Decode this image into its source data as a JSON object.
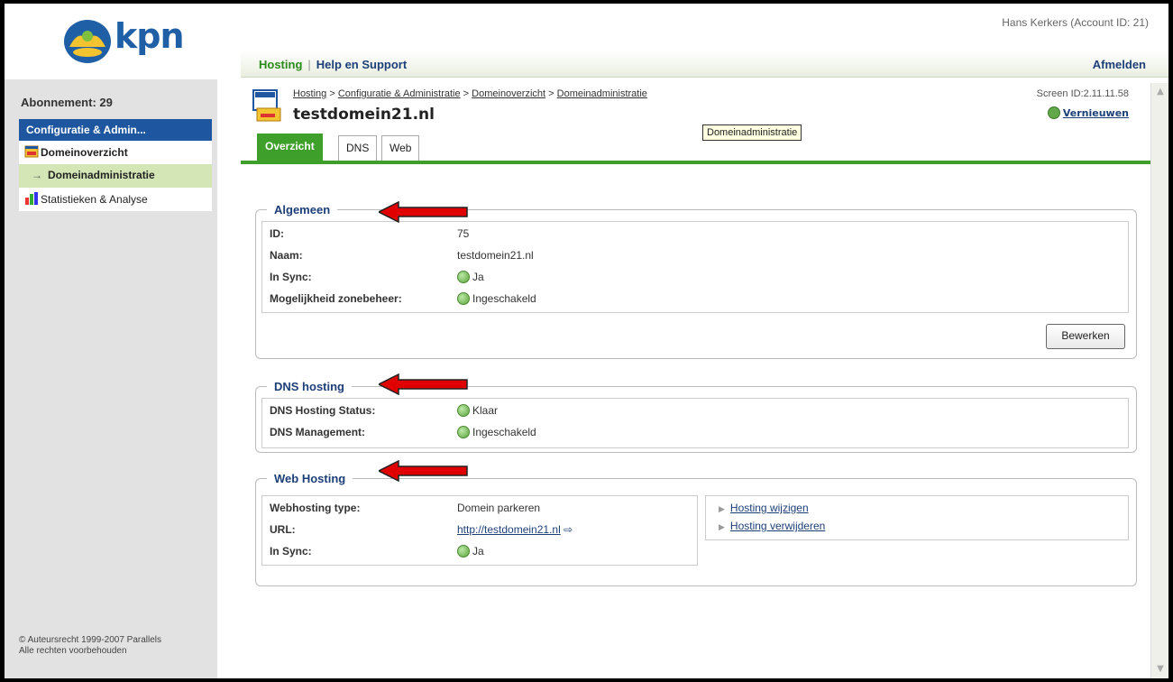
{
  "header": {
    "logo_text": "kpn",
    "user_info": "Hans Kerkers (Account ID: 21)",
    "nav": {
      "hosting": "Hosting",
      "separator": "|",
      "help": "Help en Support",
      "logout": "Afmelden"
    }
  },
  "sidebar": {
    "subscription": "Abonnement: 29",
    "section": "Configuratie & Admin...",
    "items": [
      {
        "label": "Domeinoverzicht",
        "icon": "domain-icon"
      },
      {
        "label": "Domeinadministratie",
        "icon": "arrow-icon"
      },
      {
        "label": "Statistieken & Analyse",
        "icon": "chart-icon"
      }
    ],
    "copyright_line1": "© Auteursrecht 1999-2007 Parallels",
    "copyright_line2": "Alle rechten voorbehouden"
  },
  "main": {
    "breadcrumb": {
      "items": [
        "Hosting",
        "Configuratie & Administratie",
        "Domeinoverzicht",
        "Domeinadministratie"
      ],
      "separator": ">"
    },
    "title": "testdomein21.nl",
    "screen_id": "Screen ID:2.11.11.58",
    "refresh": "Vernieuwen",
    "tooltip": "Domeinadministratie",
    "tabs": [
      "Overzicht",
      "DNS",
      "Web"
    ],
    "general": {
      "legend": "Algemeen",
      "rows": [
        {
          "label": "ID:",
          "value": "75"
        },
        {
          "label": "Naam:",
          "value": "testdomein21.nl"
        },
        {
          "label": "In Sync:",
          "value": "Ja"
        },
        {
          "label": "Mogelijkheid zonebeheer:",
          "value": "Ingeschakeld"
        }
      ],
      "edit_button": "Bewerken"
    },
    "dns": {
      "legend": "DNS hosting",
      "rows": [
        {
          "label": "DNS Hosting Status:",
          "value": "Klaar"
        },
        {
          "label": "DNS Management:",
          "value": "Ingeschakeld"
        }
      ]
    },
    "web": {
      "legend": "Web Hosting",
      "rows": [
        {
          "label": "Webhosting type:",
          "value": "Domein parkeren"
        },
        {
          "label": "URL:",
          "value": "http://testdomein21.nl"
        },
        {
          "label": "In Sync:",
          "value": "Ja"
        }
      ],
      "actions": [
        "Hosting wijzigen",
        "Hosting verwijderen"
      ]
    }
  },
  "colors": {
    "brand_blue": "#1e56a0",
    "green": "#3ea02a",
    "annotation_red": "#e00000"
  }
}
